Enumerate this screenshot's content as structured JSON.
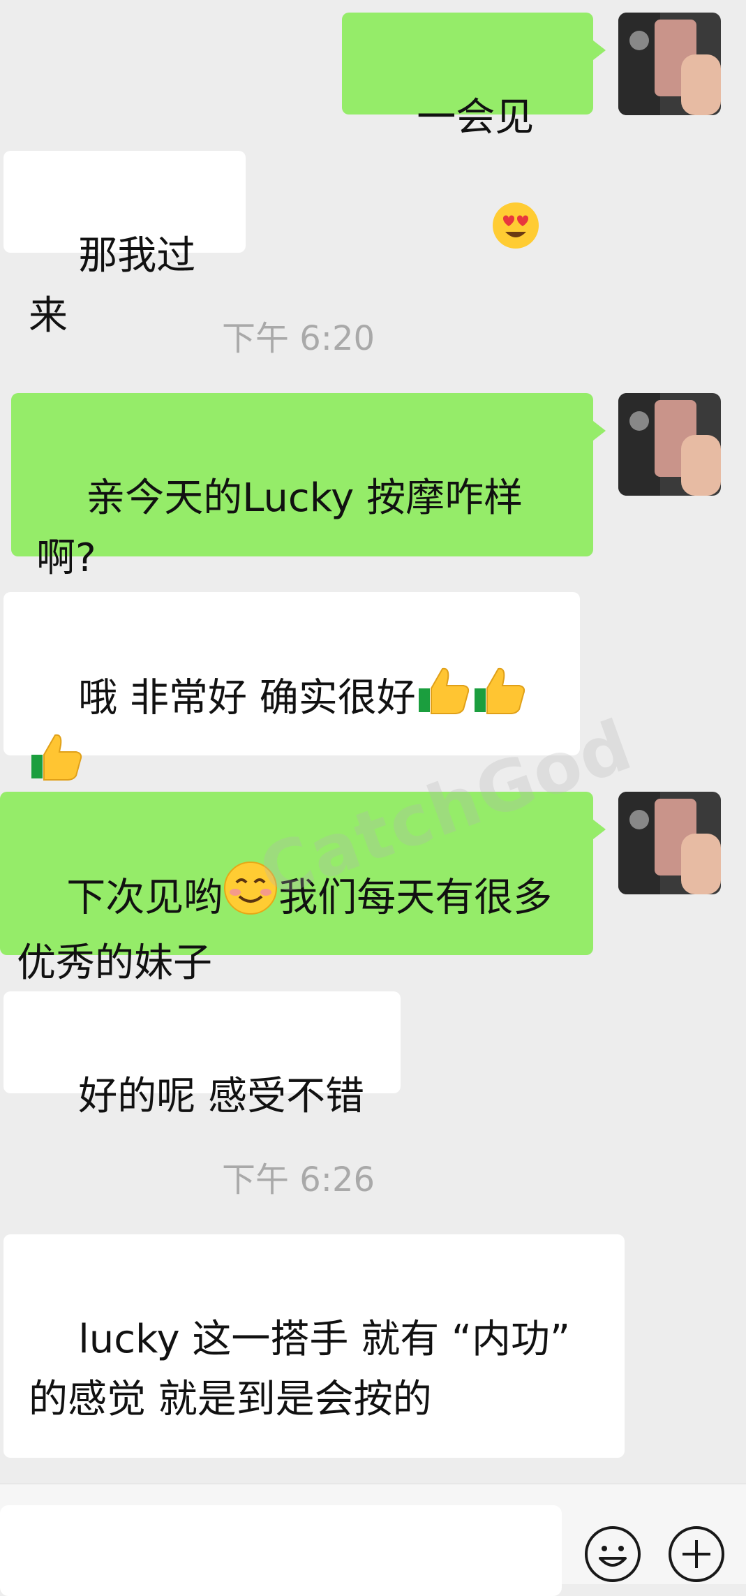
{
  "messages": [
    {
      "type": "out",
      "text": "一会见",
      "emoji": "heart-eyes-emoji"
    },
    {
      "type": "in",
      "text": "那我过来"
    },
    {
      "type": "time",
      "text": "下午 6:20"
    },
    {
      "type": "out",
      "text": "亲今天的Lucky 按摩咋样啊?"
    },
    {
      "type": "in",
      "text": "哦 非常好 确实很好",
      "emoji": "thumbs-up-emoji x3"
    },
    {
      "type": "out",
      "text_before": "下次见哟",
      "text_after": "我们每天有很多优秀的妹子",
      "emoji": "smiling-face-emoji"
    },
    {
      "type": "in",
      "text": "好的呢 感受不错"
    },
    {
      "type": "time",
      "text": "下午 6:26"
    },
    {
      "type": "in",
      "text": "lucky 这一搭手 就有 “内功” 的感觉 就是到是会按的"
    }
  ],
  "watermark": {
    "text": "CatchGod"
  },
  "input_bar": {
    "input_value": "",
    "icons": [
      "emoji-icon",
      "plus-icon"
    ]
  },
  "colors": {
    "background": "#ededed",
    "outgoing_bubble": "#95ec69",
    "incoming_bubble": "#ffffff",
    "timestamp": "#a9a9a9"
  }
}
